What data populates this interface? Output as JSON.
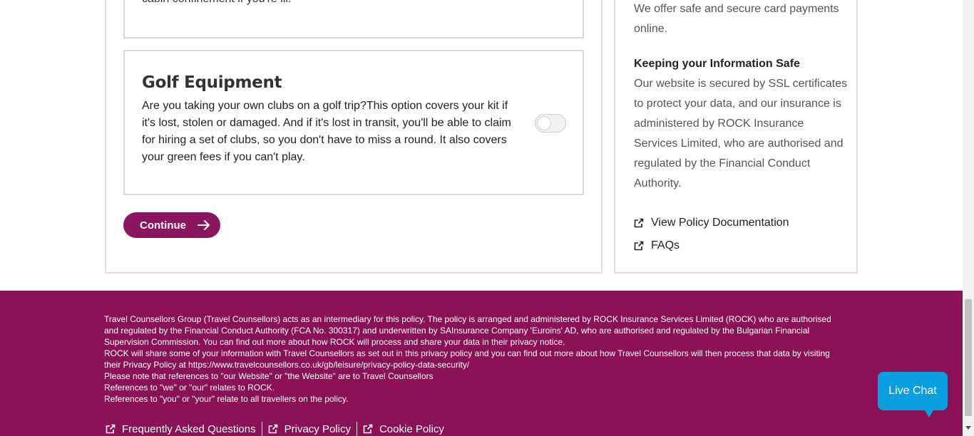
{
  "previous_card": {
    "text_tail": "cabin confinement if you're ill."
  },
  "golf_card": {
    "title": "Golf Equipment",
    "description": "Are you taking your own clubs on a golf trip?This option covers your kit if it's lost, stolen or damaged. And if it's lost in transit, you'll be able to claim for hiring a set of clubs, so you don't have to miss a round. It also covers your green fees if you can't play.",
    "toggle_state": "off"
  },
  "actions": {
    "continue_label": "Continue"
  },
  "sidebar": {
    "secure_payments": "We offer safe and secure card payments online.",
    "info_heading": "Keeping your Information Safe",
    "info_body": "Our website is secured by SSL certificates to protect your data, and our insurance is administered by ROCK Insurance Services Limited, who are authorised and regulated by the Financial Conduct Authority.",
    "link_policy_docs": "View Policy Documentation",
    "link_faqs": "FAQs"
  },
  "footer": {
    "paragraph_1": "Travel Counsellors Group (Travel Counsellors) acts as an intermediary for this policy. The policy is arranged and administered by ROCK Insurance Services Limited (ROCK) who are authorised and regulated by the Financial Conduct Authority (FCA No. 300317) and underwritten by SAInsurance Company 'Euroins' AD, who are authorised and regulated by the Bulgarian Financial Supervision Commission. You can find out more about how ROCK will process and share your data in their privacy notice.",
    "paragraph_2": "ROCK will share some of your information with Travel Counsellors as set out in this privacy policy and you can find out more about how Travel Counsellors will then process that data by visiting their Privacy Policy at https://www.travelcounsellors.co.uk/gb/leisure/privacy-policy-data-security/",
    "paragraph_3": "Please note that references to \"our Website\" or \"the Website\" are to Travel Counsellors",
    "paragraph_4": "References to \"we\" or \"our\" relates to ROCK.",
    "paragraph_5": "References to \"you\" or \"your\" relate to all travellers on the policy.",
    "links": [
      "Frequently Asked Questions",
      "Privacy Policy",
      "Cookie Policy"
    ]
  },
  "live_chat": {
    "label": "Live Chat"
  },
  "colors": {
    "brand_primary": "#8b1660",
    "footer_bg": "#8b1157",
    "chat_bg": "#0aa0df"
  },
  "icons": {
    "continue_arrow": "arrow-right-icon",
    "external_link": "external-link-icon"
  }
}
